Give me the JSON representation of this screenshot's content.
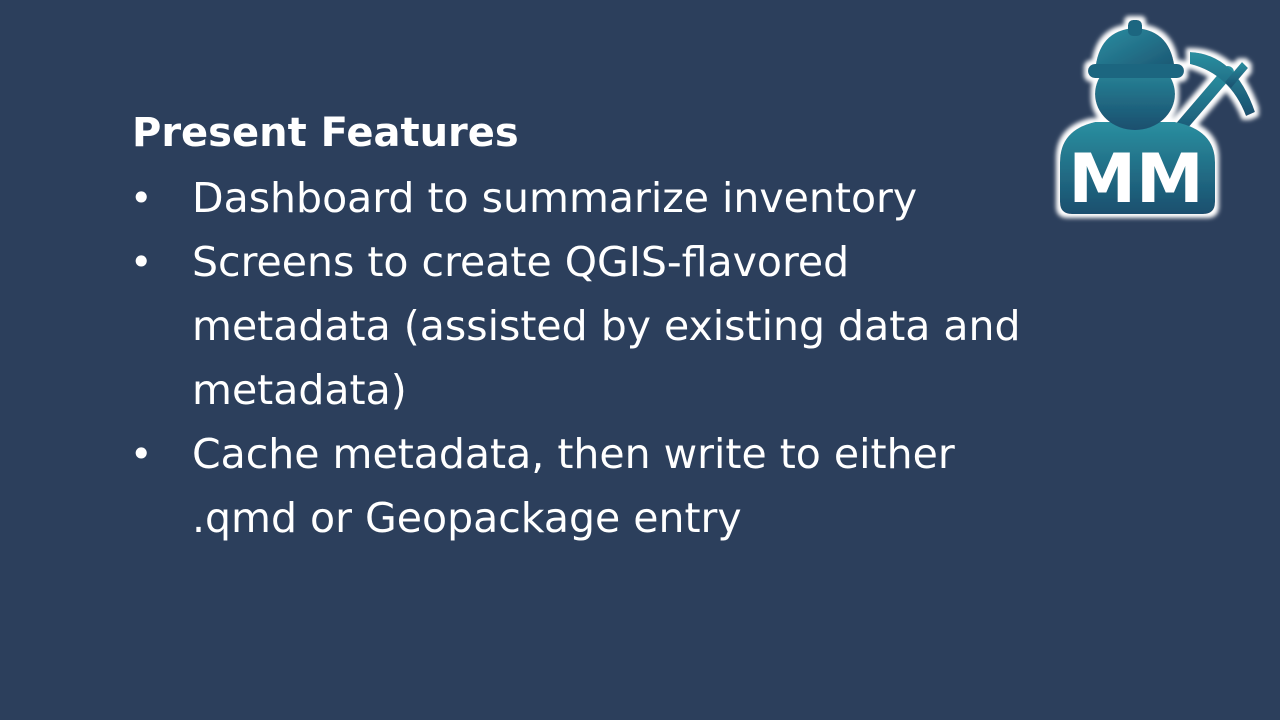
{
  "slide": {
    "heading": "Present Features",
    "bullets": [
      {
        "marker": "•",
        "text": "Dashboard to summarize inventory"
      },
      {
        "marker": "•",
        "text": "Screens to create QGIS-flavored metadata (assisted by existing data and metadata)"
      },
      {
        "marker": "•",
        "text": "Cache metadata, then write to either .qmd or Geopackage entry"
      }
    ],
    "logo": {
      "text": "MM",
      "icon": "miner-with-pickaxe-icon"
    }
  },
  "colors": {
    "background": "#2c3f5c",
    "text": "#ffffff",
    "logo_teal_light": "#2a8fa0",
    "logo_teal_dark": "#1a4f6e"
  }
}
